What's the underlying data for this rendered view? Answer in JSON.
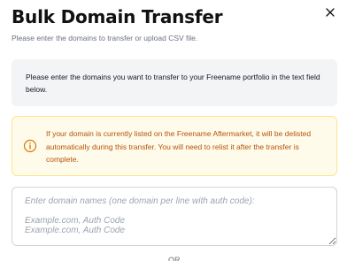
{
  "modal": {
    "title": "Bulk Domain Transfer",
    "subtitle": "Please enter the domains to transfer or upload CSV file.",
    "close_icon": "close-icon"
  },
  "info": {
    "text": "Please enter the domains you want to transfer to your Freename portfolio in the text field below."
  },
  "warning": {
    "icon": "info-circle-icon",
    "text": "If your domain is currently listed on the Freename Aftermarket, it will be delisted automatically during this transfer. You will need to relist it after the transfer is complete.",
    "color": "#b45309",
    "background": "#fffbeb"
  },
  "domain_input": {
    "placeholder": "Enter domain names (one domain per line with auth code):\n\nExample.com, Auth Code\nExample.com, Auth Code",
    "value": ""
  },
  "footer": {
    "partial_text": "OR"
  }
}
